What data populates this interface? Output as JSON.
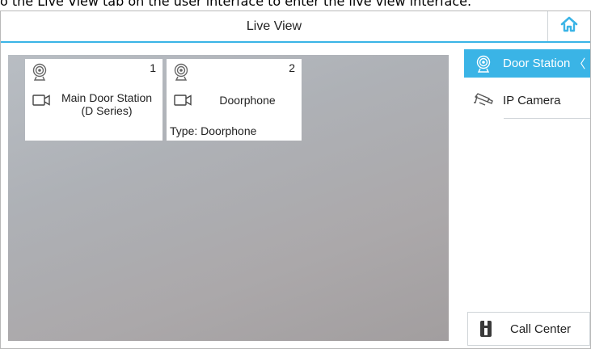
{
  "caption": "o the Live View tab on the user interface to enter the live view interface.",
  "header": {
    "title": "Live View",
    "home_icon": "home-icon"
  },
  "devices": [
    {
      "number": "1",
      "name": "Main Door Station (D Series)",
      "type": "",
      "camera_icon": "camera-icon",
      "video_icon": "video-icon"
    },
    {
      "number": "2",
      "name": "Doorphone",
      "type": "Type: Doorphone",
      "camera_icon": "camera-icon",
      "video_icon": "video-icon"
    }
  ],
  "sidebar": {
    "items": [
      {
        "label": "Door Station",
        "icon": "door-station-icon",
        "active": true,
        "chevron": "〈"
      },
      {
        "label": "IP Camera",
        "icon": "ip-camera-icon",
        "active": false
      }
    ],
    "call_center": {
      "label": "Call Center",
      "icon": "call-center-icon"
    }
  },
  "colors": {
    "accent": "#3ab4e6",
    "panel": "#aeb1b6"
  }
}
